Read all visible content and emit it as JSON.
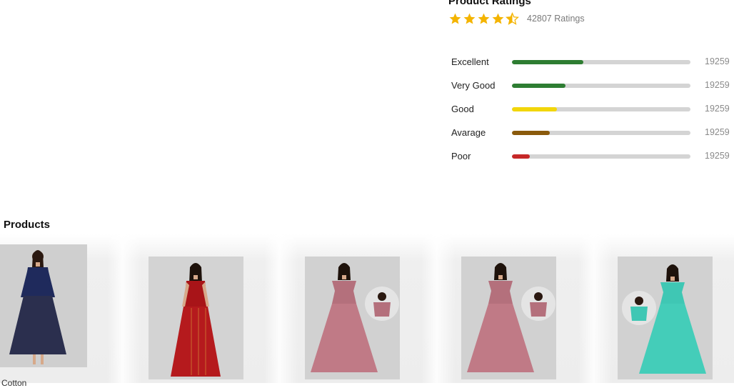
{
  "ratings": {
    "title": "Product Ratings",
    "stars": {
      "value": 4.5,
      "max": 5,
      "icon": "star-icon",
      "color": "#f4b400"
    },
    "count_text": "42807 Ratings",
    "rows": [
      {
        "label": "Excellent",
        "value": "19259",
        "fill_fraction": 0.4,
        "color": "#2e7d32"
      },
      {
        "label": "Very Good",
        "value": "19259",
        "fill_fraction": 0.3,
        "color": "#2e7d32"
      },
      {
        "label": "Good",
        "value": "19259",
        "fill_fraction": 0.25,
        "color": "#f2d60a"
      },
      {
        "label": "Avarage",
        "value": "19259",
        "fill_fraction": 0.21,
        "color": "#8a5a0c"
      },
      {
        "label": "Poor",
        "value": "19259",
        "fill_fraction": 0.1,
        "color": "#c62828"
      }
    ]
  },
  "products": {
    "heading": "Products",
    "items": [
      {
        "image": "navy-floral-kurti",
        "dress_color": "#1f2a5c",
        "skirt_color": "#2b2f4e"
      },
      {
        "image": "red-gold-anarkali",
        "dress_color": "#a81418",
        "skirt_color": "#b51a1d"
      },
      {
        "image": "pink-floral-gown",
        "dress_color": "#b4707c",
        "skirt_color": "#c07a86"
      },
      {
        "image": "pink-floral-gown",
        "dress_color": "#b4707c",
        "skirt_color": "#c07a86"
      },
      {
        "image": "teal-floral-gown",
        "dress_color": "#3fc7b4",
        "skirt_color": "#44cdb9"
      }
    ],
    "next_item_name_partial": "Cotton"
  }
}
